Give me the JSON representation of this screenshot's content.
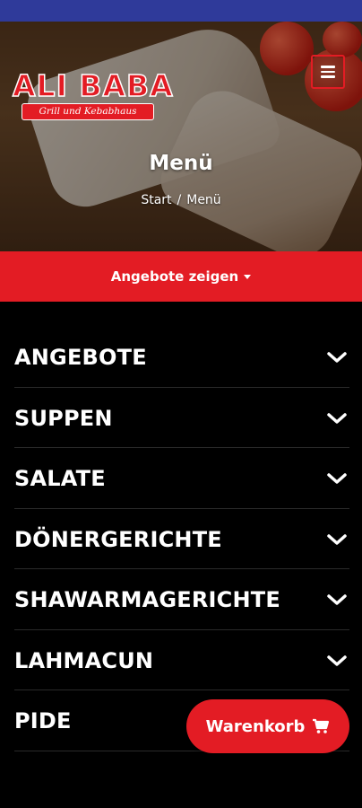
{
  "header": {
    "logo_title": "ALI BABA",
    "logo_subtitle": "Grill und Kebabhaus",
    "menu_icon": "hamburger-icon"
  },
  "page": {
    "title": "Menü",
    "breadcrumb": [
      "Start",
      "Menü"
    ],
    "breadcrumb_separator": "/"
  },
  "offers": {
    "label": "Angebote zeigen",
    "icon": "caret-down-icon"
  },
  "categories": [
    {
      "label": "ANGEBOTE",
      "icon": "chevron-down-icon"
    },
    {
      "label": "SUPPEN",
      "icon": "chevron-down-icon"
    },
    {
      "label": "SALATE",
      "icon": "chevron-down-icon"
    },
    {
      "label": "DÖNERGERICHTE",
      "icon": "chevron-down-icon"
    },
    {
      "label": "SHAWARMAGERICHTE",
      "icon": "chevron-down-icon"
    },
    {
      "label": "LAHMACUN",
      "icon": "chevron-down-icon"
    },
    {
      "label": "PIDE",
      "icon": "chevron-down-icon"
    }
  ],
  "cart": {
    "label": "Warenkorb",
    "icon": "cart-icon"
  },
  "colors": {
    "accent": "#e31c24",
    "status_bar": "#2f3a9a",
    "background": "#000000"
  }
}
